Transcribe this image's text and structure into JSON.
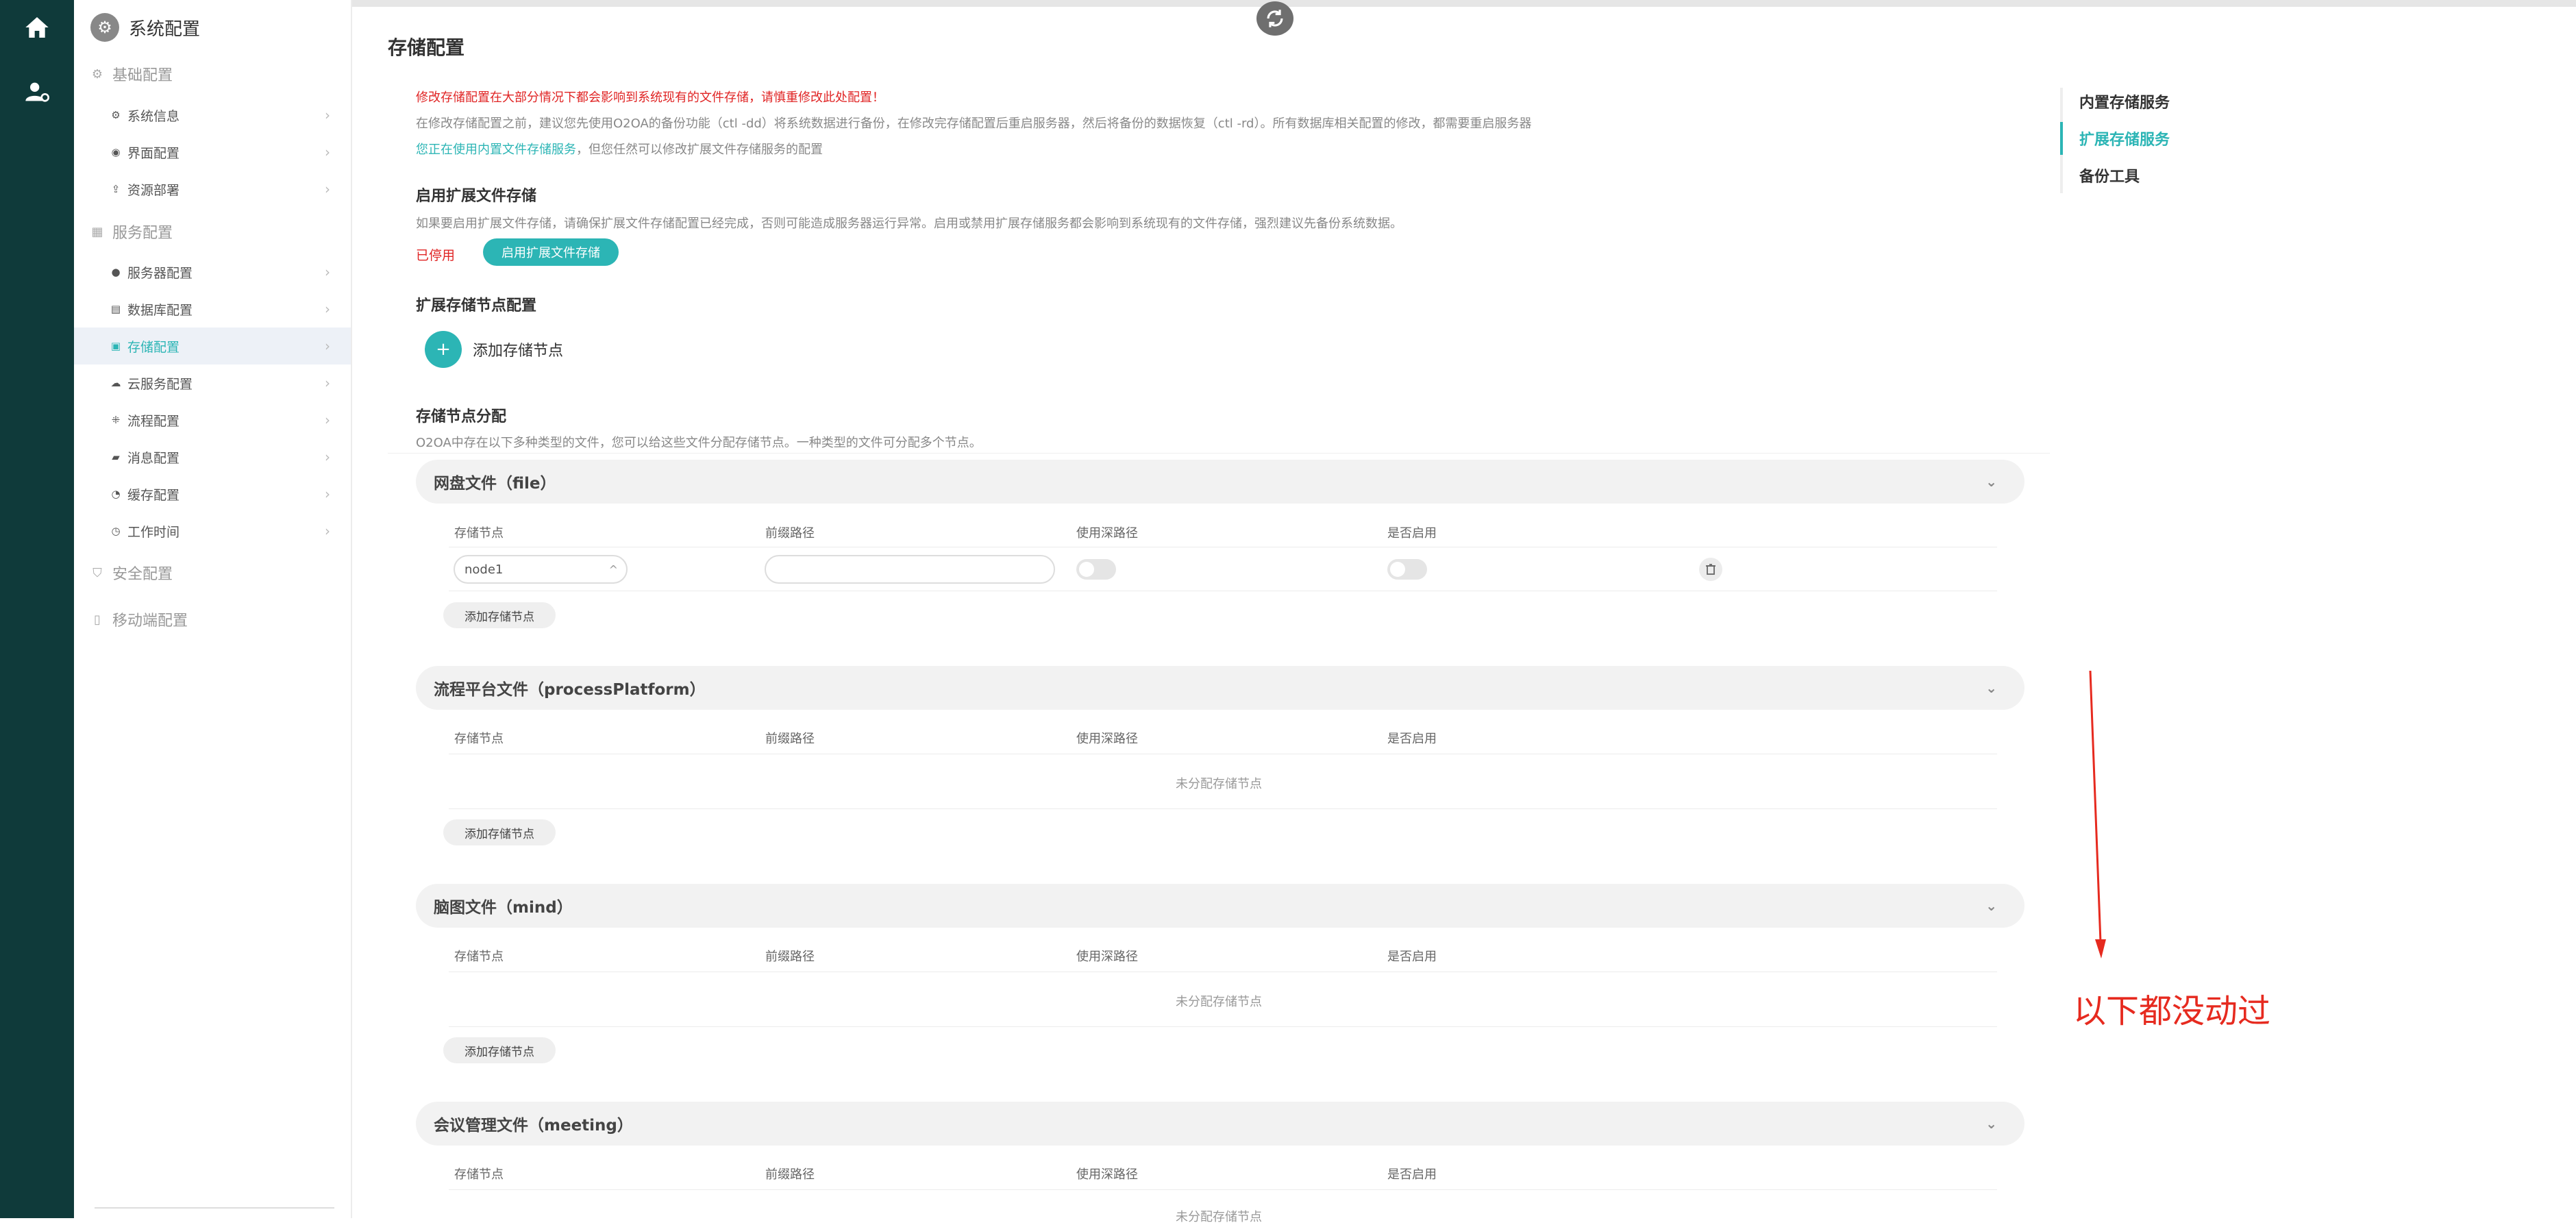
{
  "sidebar": {
    "title": "系统配置",
    "groups": [
      {
        "label": "基础配置"
      },
      {
        "label": "服务配置"
      },
      {
        "label": "安全配置"
      },
      {
        "label": "移动端配置"
      }
    ],
    "items": [
      {
        "label": "系统信息"
      },
      {
        "label": "界面配置"
      },
      {
        "label": "资源部署"
      },
      {
        "label": "服务器配置"
      },
      {
        "label": "数据库配置"
      },
      {
        "label": "存储配置"
      },
      {
        "label": "云服务配置"
      },
      {
        "label": "流程配置"
      },
      {
        "label": "消息配置"
      },
      {
        "label": "缓存配置"
      },
      {
        "label": "工作时间"
      }
    ],
    "active_item": "存储配置"
  },
  "page": {
    "title": "存储配置",
    "warning": "修改存储配置在大部分情况下都会影响到系统现有的文件存储，请慎重修改此处配置！",
    "tip": "在修改存储配置之前，建议您先使用O2OA的备份功能（ctl -dd）将系统数据进行备份，在修改完存储配置后重启服务器，然后将备份的数据恢复（ctl -rd）。所有数据库相关配置的修改，都需要重启服务器",
    "using_prefix": "您正在使用内置文件存储服务",
    "using_suffix": "，但您任然可以修改扩展文件存储服务的配置"
  },
  "extended": {
    "title": "启用扩展文件存储",
    "desc": "如果要启用扩展文件存储，请确保扩展文件存储配置已经完成，否则可能造成服务器运行异常。启用或禁用扩展存储服务都会影响到系统现有的文件存储，强烈建议先备份系统数据。",
    "status": "已停用",
    "enable_button": "启用扩展文件存储"
  },
  "nodes": {
    "title": "扩展存储节点配置",
    "add_button": "添加存储节点"
  },
  "distribution": {
    "title": "存储节点分配",
    "desc": "O2OA中存在以下多种类型的文件，您可以给这些文件分配存储节点。一种类型的文件可分配多个节点。",
    "columns": [
      "存储节点",
      "前缀路径",
      "使用深路径",
      "是否启用"
    ],
    "add_button": "添加存储节点",
    "empty_text": "未分配存储节点",
    "panels": [
      {
        "name": "网盘文件（file）",
        "rows": [
          {
            "node": "node1",
            "prefix": "",
            "deep_path": false,
            "enabled": false
          }
        ]
      },
      {
        "name": "流程平台文件（processPlatform）",
        "rows": []
      },
      {
        "name": "脑图文件（mind）",
        "rows": []
      },
      {
        "name": "会议管理文件（meeting）",
        "rows": []
      }
    ]
  },
  "right_nav": {
    "items": [
      "内置存储服务",
      "扩展存储服务",
      "备份工具"
    ],
    "active": "扩展存储服务"
  },
  "annotation": {
    "text": "以下都没动过",
    "color": "#e62a1f"
  },
  "colors": {
    "accent": "#2cb5b5",
    "rail": "#0f3a3a",
    "warning": "#e02424"
  }
}
